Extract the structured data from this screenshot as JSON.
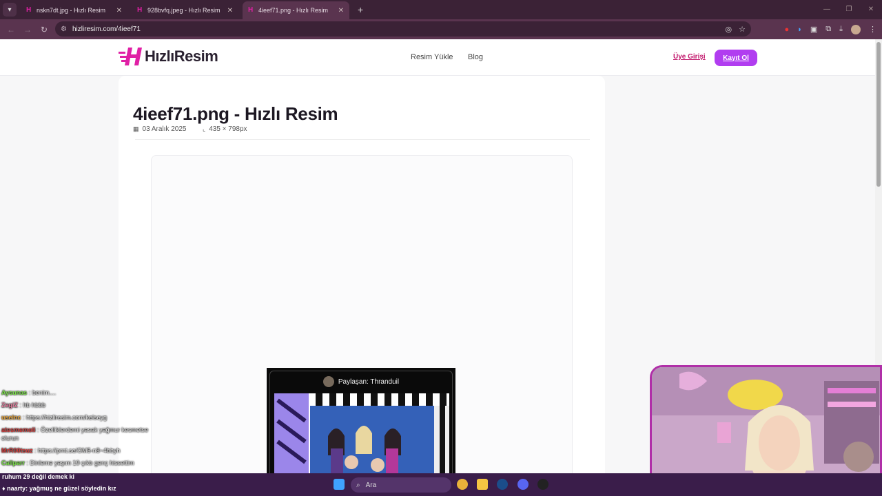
{
  "browser": {
    "tabs": [
      {
        "label": "nskn7dt.jpg - Hızlı Resim",
        "active": false
      },
      {
        "label": "928bvfq.jpeg - Hızlı Resim",
        "active": false
      },
      {
        "label": "4ieef71.png - Hızlı Resim",
        "active": true
      }
    ],
    "url": "hizliresim.com/4ieef71",
    "accent": "#5a344f"
  },
  "site": {
    "logo": "HızlıResim",
    "nav": [
      "Resim Yükle",
      "Blog"
    ],
    "login": "Üye Girişi",
    "signup": "Kayıt Ol",
    "brand_color": "#b13df0"
  },
  "image": {
    "title": "4ieef71.png - Hızlı Resim",
    "date": "03 Aralık 2025",
    "dimensions": "435 × 798px",
    "shared_by": "Paylaşan: Thranduil"
  },
  "chat": [
    {
      "user": "Aysunas",
      "msg": ": benim....",
      "color": "#7be04a"
    },
    {
      "user": "ZegiZ",
      "msg": ": hb hbbb",
      "color": "#e87fa0"
    },
    {
      "user": "uselnc",
      "msg": ": https://hizliresim.com/kelseyg",
      "color": "#e7a43a"
    },
    {
      "user": "atesmemoli",
      "msg": ": Özelliklerdemi yasak yağmur kesmetse olurun",
      "color": "#d43c3c"
    },
    {
      "user": "MrR00tsuz",
      "msg": ": https://prnt.se/OM5-n8~4bbyh",
      "color": "#d43c3c"
    },
    {
      "user": "Callparr",
      "msg": ": Dinleme yaşım 19 çıktı genç hissettim",
      "color": "#7be04a"
    },
    {
      "user": "",
      "msg": "ruhum 29 değil demek ki",
      "color": "#ffffff"
    },
    {
      "user": "naarty",
      "msg": ": yağmuş ne güzel söyledin kız",
      "color": "#ffffff"
    }
  ],
  "taskbar": {
    "search_placeholder": "Ara"
  }
}
